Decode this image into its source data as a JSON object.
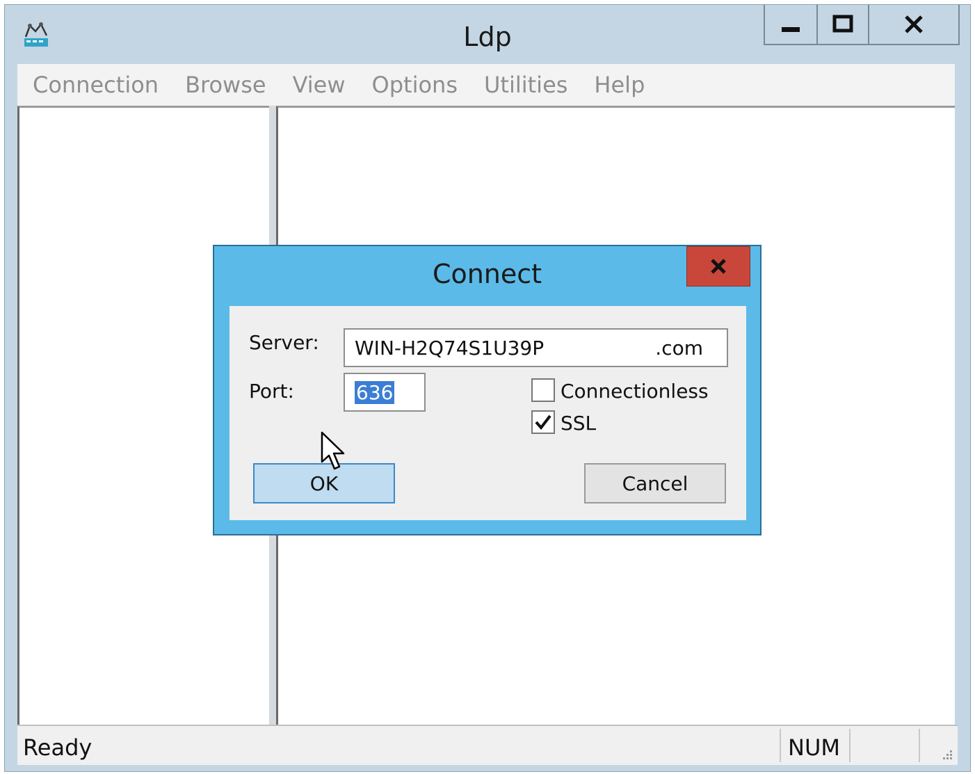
{
  "window": {
    "title": "Ldp",
    "icon": "ldp-app-icon",
    "controls": {
      "minimize": "minimize-icon",
      "maximize": "maximize-icon",
      "close": "close-icon"
    }
  },
  "menu": {
    "items": [
      "Connection",
      "Browse",
      "View",
      "Options",
      "Utilities",
      "Help"
    ]
  },
  "dialog": {
    "title": "Connect",
    "server_label": "Server:",
    "server_value": "WIN-H2Q74S1U39P",
    "server_suffix": ".com",
    "port_label": "Port:",
    "port_value": "636",
    "connectionless_label": "Connectionless",
    "connectionless_checked": false,
    "ssl_label": "SSL",
    "ssl_checked": true,
    "ok_label": "OK",
    "cancel_label": "Cancel"
  },
  "status": {
    "text": "Ready",
    "num": "NUM"
  },
  "colors": {
    "dialog_frame": "#5bbae8",
    "close_button": "#c9473a",
    "selection": "#3b7ed4"
  }
}
